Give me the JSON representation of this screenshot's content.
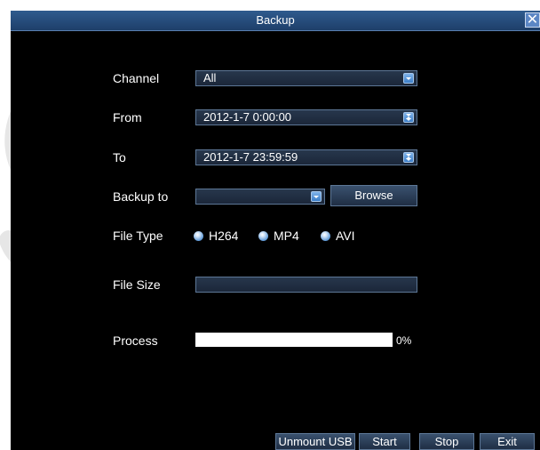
{
  "dialog": {
    "title": "Backup",
    "close_glyph": "✕"
  },
  "form": {
    "channel": {
      "label": "Channel",
      "value": "All"
    },
    "from": {
      "label": "From",
      "value": "2012-1-7 0:00:00"
    },
    "to": {
      "label": "To",
      "value": "2012-1-7 23:59:59"
    },
    "backup_to": {
      "label": "Backup to",
      "value": "",
      "browse_label": "Browse"
    },
    "file_type": {
      "label": "File Type",
      "options": [
        "H264",
        "MP4",
        "AVI"
      ]
    },
    "file_size": {
      "label": "File Size",
      "value": ""
    },
    "process": {
      "label": "Process",
      "percent_text": "0%",
      "fraction": 0
    }
  },
  "buttons": {
    "unmount_usb": "Unmount USB",
    "start": "Start",
    "stop": "Stop",
    "exit": "Exit"
  },
  "icons": [
    "dropdown-arrow-icon",
    "spinner-icon",
    "close-icon",
    "radio-icon"
  ],
  "colors": {
    "titlebar": "#2f5b8e",
    "background": "#000000",
    "accent": "#5b86c4"
  }
}
